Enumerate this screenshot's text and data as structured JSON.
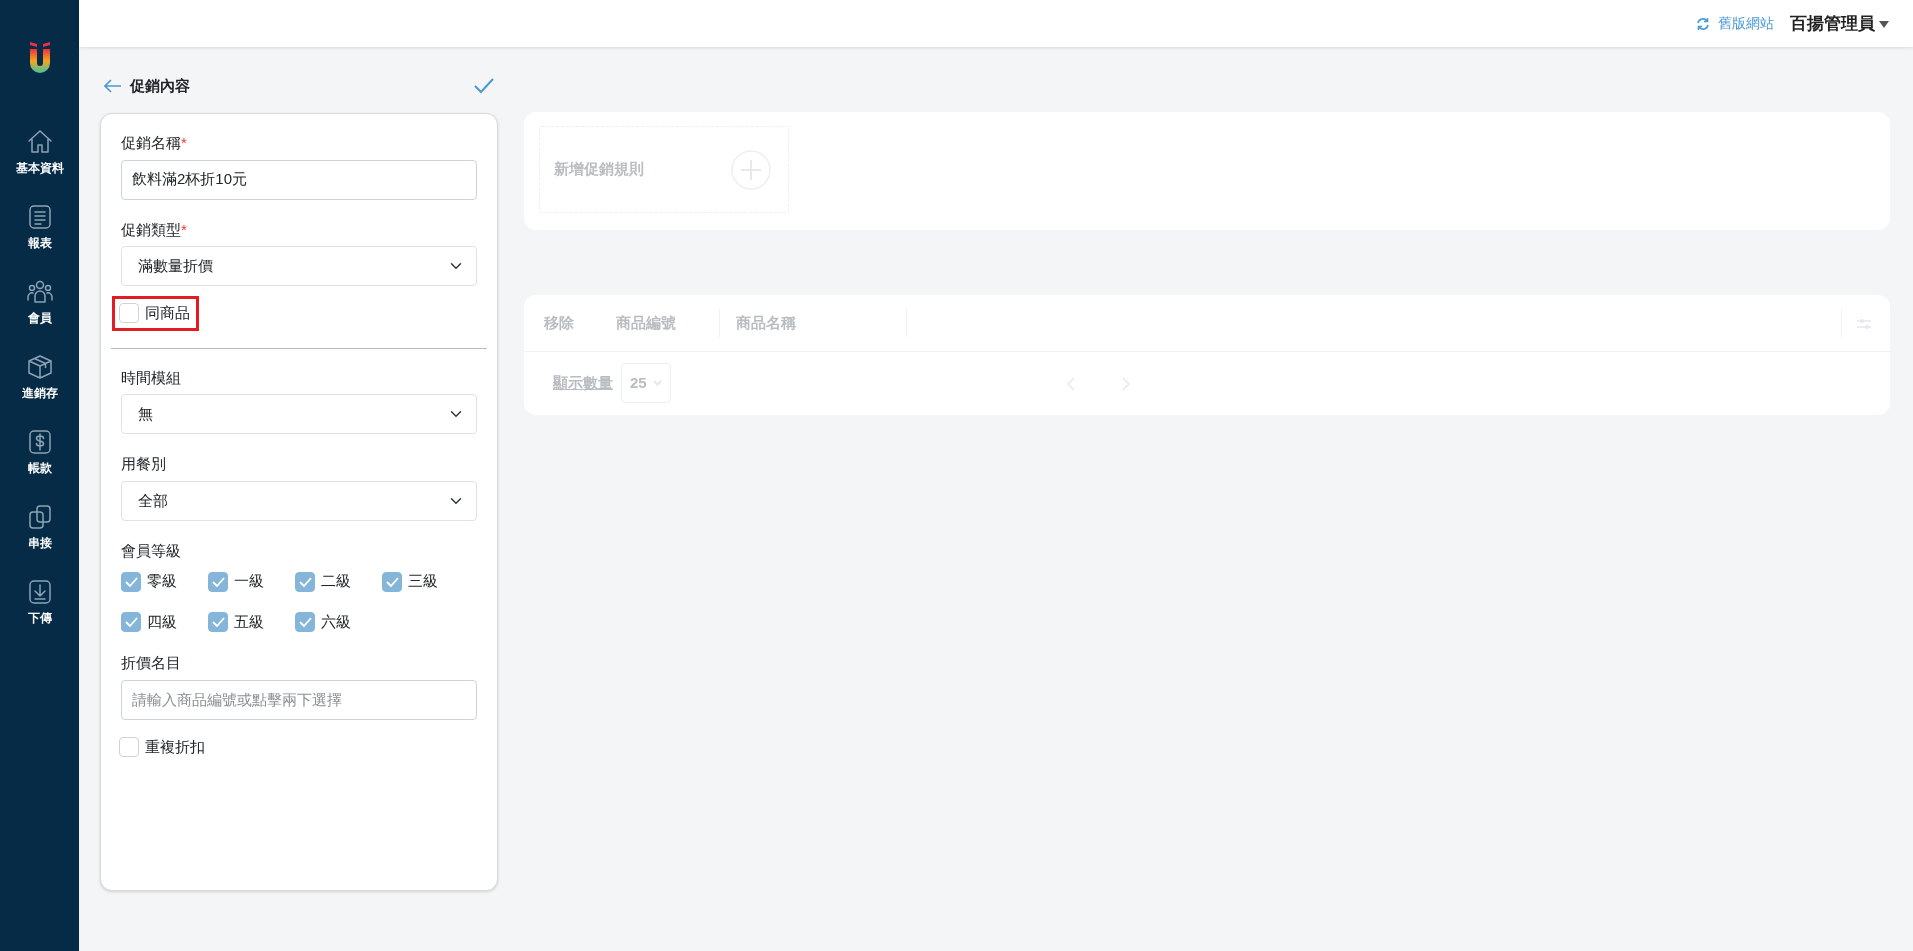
{
  "header": {
    "old_site_link": "舊版網站",
    "user_menu": "百揚管理員"
  },
  "sidebar": {
    "items": [
      {
        "label": "基本資料"
      },
      {
        "label": "報表"
      },
      {
        "label": "會員"
      },
      {
        "label": "進銷存"
      },
      {
        "label": "帳款"
      },
      {
        "label": "串接"
      },
      {
        "label": "下傳"
      }
    ]
  },
  "form": {
    "title": "促銷內容",
    "fields": [
      {
        "kind": "text",
        "label": "促銷名稱",
        "required_mark": "*",
        "value": "飲料滿2杯折10元"
      },
      {
        "kind": "select",
        "label": "促銷類型",
        "required_mark": "*",
        "value": "滿數量折價"
      },
      {
        "kind": "checkbox",
        "label": "同商品",
        "checked": false,
        "highlighted": true
      },
      {
        "kind": "divider"
      },
      {
        "kind": "select",
        "label": "時間模組",
        "value": "無"
      },
      {
        "kind": "select",
        "label": "用餐別",
        "value": "全部"
      },
      {
        "kind": "checkgroup",
        "label": "會員等級",
        "options": [
          {
            "label": "零級",
            "checked": true
          },
          {
            "label": "一級",
            "checked": true
          },
          {
            "label": "二級",
            "checked": true
          },
          {
            "label": "三級",
            "checked": true
          },
          {
            "label": "四級",
            "checked": true
          },
          {
            "label": "五級",
            "checked": true
          },
          {
            "label": "六級",
            "checked": true
          }
        ]
      },
      {
        "kind": "text",
        "label": "折價名目",
        "placeholder": "請輸入商品編號或點擊兩下選擇"
      },
      {
        "kind": "checkbox",
        "label": "重複折扣",
        "checked": false,
        "highlighted": false
      }
    ]
  },
  "rules_panel": {
    "disabled": true,
    "add_rule": "新增促銷規則"
  },
  "items_table": {
    "disabled": true,
    "columns": [
      "移除",
      "商品編號",
      "商品名稱"
    ],
    "page_size_label": "顯示數量",
    "page_size": "25"
  }
}
